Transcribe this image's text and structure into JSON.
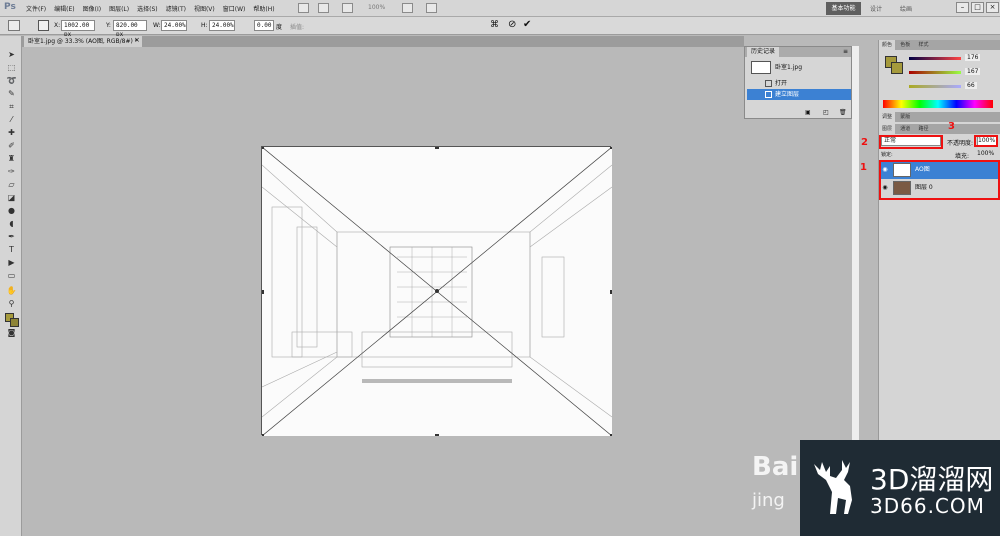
{
  "menubar": {
    "logo": "Ps",
    "items": [
      "文件(F)",
      "编辑(E)",
      "图像(I)",
      "图层(L)",
      "选择(S)",
      "滤镜(T)",
      "视图(V)",
      "窗口(W)",
      "帮助(H)"
    ],
    "zoom": "100%",
    "workspace": "基本功能",
    "workspace2": "设计",
    "workspace3": "绘画"
  },
  "options": {
    "x_label": "X:",
    "x": "1002.00 px",
    "y_label": "Y:",
    "y": "820.00 px",
    "w_label": "W:",
    "w": "24.00%",
    "h_label": "H:",
    "h": "24.00%",
    "angle": "0.00",
    "interp": "度",
    "warp": "插值:"
  },
  "doc": {
    "tab": "卧室1.jpg @ 33.3% (AO图, RGB/8#) *"
  },
  "history": {
    "tabs": [
      "历史记录"
    ],
    "snapshot": "卧室1.jpg",
    "items": [
      "打开",
      "建立图层"
    ]
  },
  "color": {
    "tabs": [
      "颜色",
      "色板",
      "样式"
    ],
    "r": "176",
    "g": "167",
    "b": "66"
  },
  "adjust": {
    "tabs": [
      "调整",
      "蒙版"
    ]
  },
  "layers": {
    "tabs": [
      "图层",
      "通道",
      "路径"
    ],
    "blend": "正常",
    "opacity_label": "不透明度:",
    "opacity": "100%",
    "lock_label": "锁定:",
    "fill_label": "填充:",
    "fill": "100%",
    "items": [
      {
        "name": "AO图"
      },
      {
        "name": "图层 0"
      }
    ]
  },
  "annotations": {
    "n1": "1",
    "n2": "2",
    "n3": "3"
  },
  "watermark": {
    "main": "3D溜溜网",
    "sub": "3D66.COM",
    "baidu": "Bai",
    "baidu2": "jing"
  },
  "colors": {
    "accent": "#3c81d3",
    "fg": "#a59a3c",
    "red": "#e11111"
  }
}
